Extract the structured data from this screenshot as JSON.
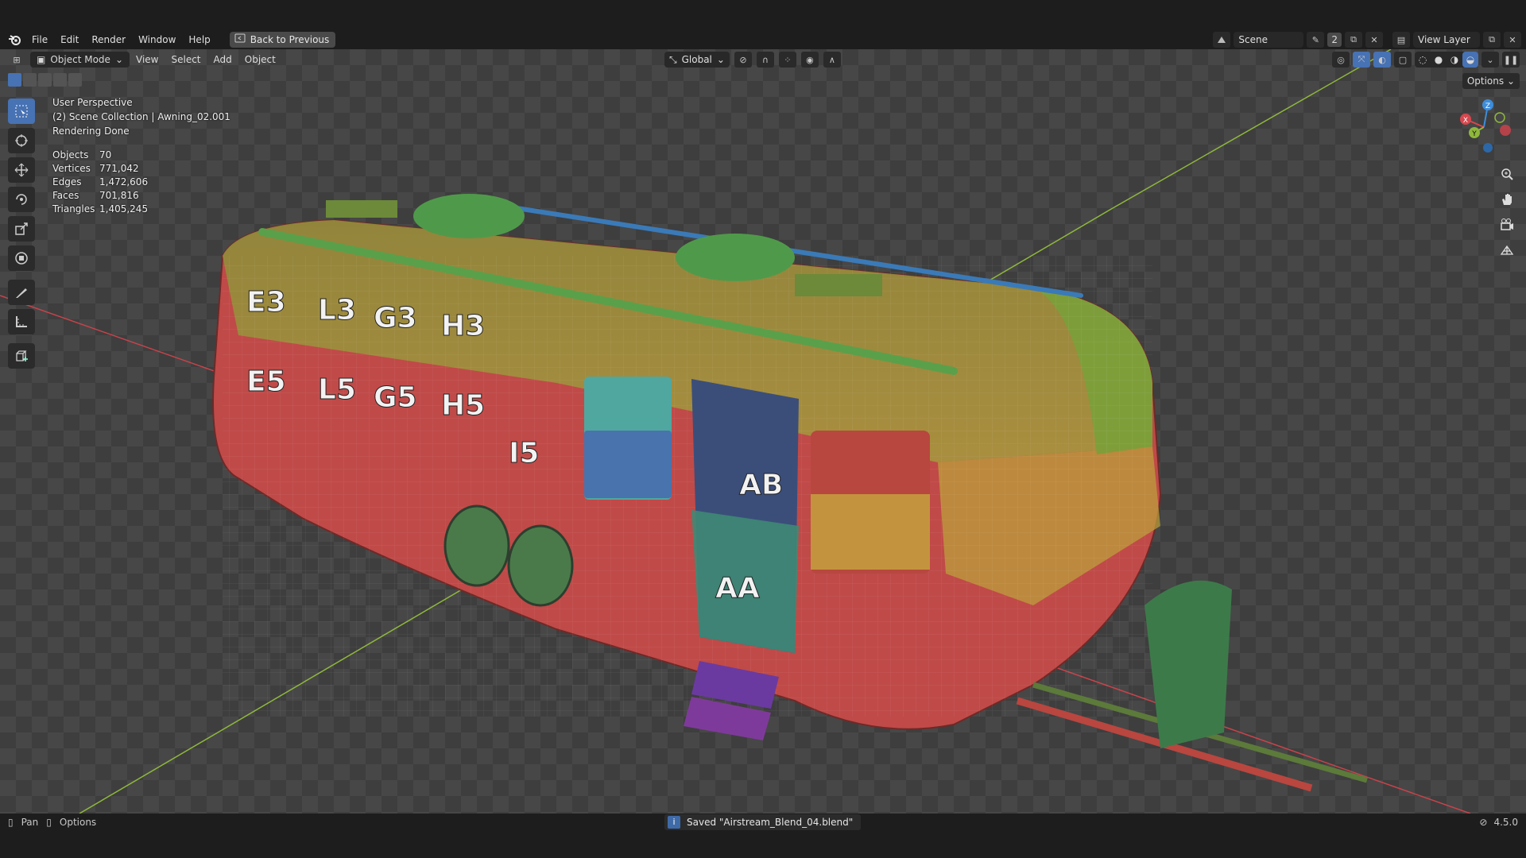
{
  "menubar": {
    "items": [
      "File",
      "Edit",
      "Render",
      "Window",
      "Help"
    ],
    "back_button": "Back to Previous"
  },
  "scene": {
    "label": "Scene",
    "users": "2"
  },
  "view_layer": {
    "label": "View Layer"
  },
  "viewport_header": {
    "mode": "Object Mode",
    "menus": [
      "View",
      "Select",
      "Add",
      "Object"
    ],
    "orientation": "Global",
    "options": "Options"
  },
  "overlay": {
    "perspective": "User Perspective",
    "collection": "(2) Scene Collection | Awning_02.001",
    "render_status": "Rendering Done"
  },
  "stats": [
    {
      "label": "Objects",
      "value": "70"
    },
    {
      "label": "Vertices",
      "value": "771,042"
    },
    {
      "label": "Edges",
      "value": "1,472,606"
    },
    {
      "label": "Faces",
      "value": "701,816"
    },
    {
      "label": "Triangles",
      "value": "1,405,245"
    }
  ],
  "gizmo": {
    "x": "X",
    "y": "Y",
    "z": "Z"
  },
  "status": {
    "pan": "Pan",
    "options": "Options",
    "message": "Saved \"Airstream_Blend_04.blend\"",
    "version": "4.5.0"
  },
  "colors": {
    "accent": "#4772b3",
    "x_axis": "#d8474e",
    "y_axis": "#8fb83b",
    "z_axis": "#3d8ddb"
  },
  "icons": [
    "blender-logo-icon",
    "back-icon",
    "select-box-icon",
    "cursor-icon",
    "move-icon",
    "rotate-icon",
    "scale-icon",
    "transform-icon",
    "annotate-icon",
    "measure-icon",
    "add-cube-icon",
    "zoom-icon",
    "hand-icon",
    "camera-icon",
    "grid-icon"
  ]
}
